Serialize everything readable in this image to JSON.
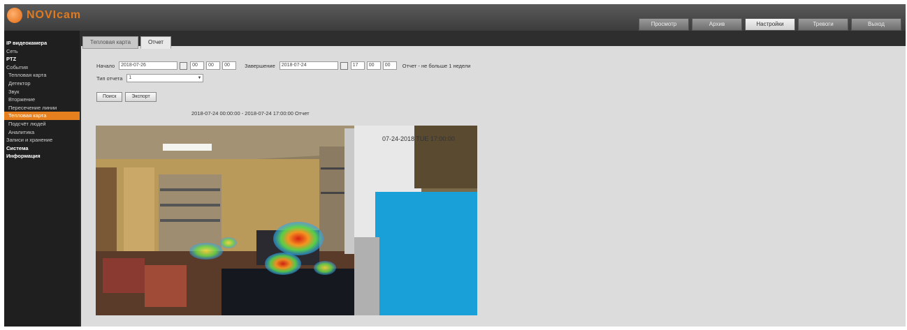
{
  "header": {
    "logo_text": "NOVIcam",
    "tabs": [
      {
        "label": "Просмотр",
        "active": false
      },
      {
        "label": "Архив",
        "active": false
      },
      {
        "label": "Настройки",
        "active": true
      },
      {
        "label": "Тревоги",
        "active": false
      },
      {
        "label": "Выход",
        "active": false
      }
    ]
  },
  "sidebar": {
    "items": [
      {
        "label": "IP видеокамера",
        "level": "bold"
      },
      {
        "label": "Сеть",
        "level": "top"
      },
      {
        "label": "PTZ",
        "level": "bold"
      },
      {
        "label": "События",
        "level": "top"
      },
      {
        "label": "Тепловая карта",
        "level": "sub"
      },
      {
        "label": "Детектор",
        "level": "sub"
      },
      {
        "label": "Звук",
        "level": "sub"
      },
      {
        "label": "Вторжение",
        "level": "sub"
      },
      {
        "label": "Пересечение линии",
        "level": "sub"
      },
      {
        "label": "Тепловая карта",
        "level": "active"
      },
      {
        "label": "Подсчёт людей",
        "level": "sub"
      },
      {
        "label": "Аналитика",
        "level": "sub"
      },
      {
        "label": "Записи и хранение",
        "level": "top"
      },
      {
        "label": "Система",
        "level": "bold"
      },
      {
        "label": "Информация",
        "level": "bold"
      }
    ]
  },
  "content": {
    "tabs": [
      {
        "label": "Тепловая карта",
        "active": false
      },
      {
        "label": "Отчет",
        "active": true
      }
    ],
    "form": {
      "start_label": "Начало",
      "start_date": "2018-07-26",
      "start_h": "00",
      "start_m": "00",
      "start_s": "00",
      "end_label": "Завершение",
      "end_date": "2018-07-24",
      "end_h": "17",
      "end_m": "00",
      "end_s": "00",
      "note": "Отчет - не больше 1 недели",
      "type_label": "Тип отчета",
      "type_value": "1",
      "search_button": "Поиск",
      "export_button": "Экспорт"
    },
    "result_caption": "2018-07-24 00:00:00 - 2018-07-24 17:00:00 Отчет",
    "camera_timestamp": "07-24-2018 TUE 17:00:00"
  }
}
